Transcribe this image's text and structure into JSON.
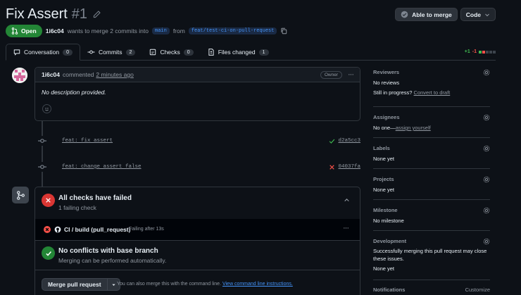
{
  "header": {
    "title": "Fix Assert",
    "number": "#1",
    "able_to_merge_label": "Able to merge",
    "code_label": "Code"
  },
  "pr_meta": {
    "state": "Open",
    "author": "1i6c04",
    "action_text": "wants to merge 2 commits into",
    "base_branch": "main",
    "from_text": "from",
    "head_branch": "feat/test-ci-on-pull-request"
  },
  "tabs": [
    {
      "label": "Conversation",
      "count": "0"
    },
    {
      "label": "Commits",
      "count": "2"
    },
    {
      "label": "Checks",
      "count": "0"
    },
    {
      "label": "Files changed",
      "count": "1"
    }
  ],
  "diffstat": {
    "added": "+1",
    "removed": "-1"
  },
  "comment": {
    "author": "1i6c04",
    "verb": "commented",
    "time": "2 minutes ago",
    "badge": "Owner",
    "body": "No description provided."
  },
  "commits": [
    {
      "message": "feat: fix assert",
      "sha": "d2a5cc3",
      "status": "success"
    },
    {
      "message": "feat: change assert false",
      "sha": "04037fa",
      "status": "failure"
    }
  ],
  "checks": {
    "title": "All checks have failed",
    "subtitle": "1 failing check",
    "job_name": "CI / build (pull_request)",
    "job_status": "Failing after 13s"
  },
  "conflicts": {
    "title": "No conflicts with base branch",
    "subtitle": "Merging can be performed automatically."
  },
  "merge": {
    "button_label": "Merge pull request",
    "hint_text": "You can also merge this with the command line.",
    "hint_link": "View command line instructions."
  },
  "sidebar": {
    "reviewers": {
      "heading": "Reviewers",
      "value": "No reviews",
      "in_progress": "Still in progress?",
      "draft_link": "Convert to draft"
    },
    "assignees": {
      "heading": "Assignees",
      "value": "No one—",
      "assign_link": "assign yourself"
    },
    "labels": {
      "heading": "Labels",
      "value": "None yet"
    },
    "projects": {
      "heading": "Projects",
      "value": "None yet"
    },
    "milestone": {
      "heading": "Milestone",
      "value": "No milestone"
    },
    "development": {
      "heading": "Development",
      "text": "Successfully merging this pull request may close these issues.",
      "value": "None yet"
    },
    "notifications": {
      "heading": "Notifications",
      "customize": "Customize"
    }
  },
  "colors": {
    "background": "#0d1117",
    "open_green": "#238636",
    "fail_red": "#da3633",
    "success_green": "#3fb950",
    "link_blue": "#4493f8"
  }
}
